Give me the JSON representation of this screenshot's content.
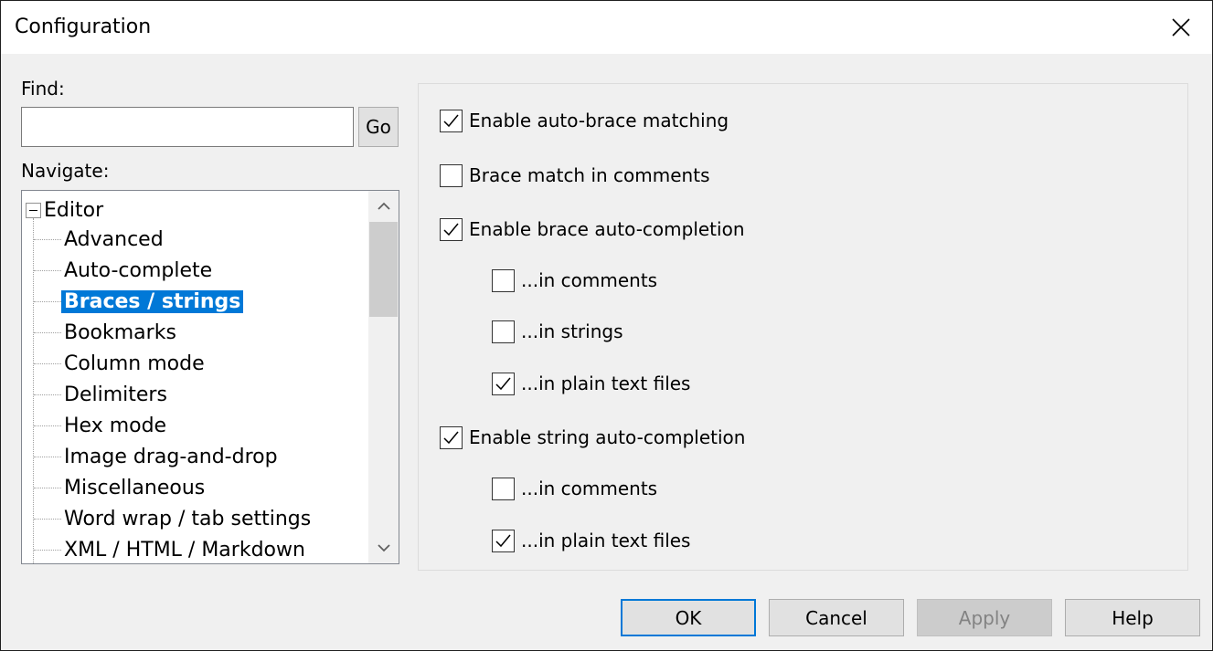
{
  "window": {
    "title": "Configuration"
  },
  "find": {
    "label": "Find:",
    "value": "",
    "go_label": "Go"
  },
  "navigate": {
    "label": "Navigate:",
    "root": "Editor",
    "items": [
      {
        "label": "Advanced",
        "selected": false
      },
      {
        "label": "Auto-complete",
        "selected": false
      },
      {
        "label": "Braces / strings",
        "selected": true
      },
      {
        "label": "Bookmarks",
        "selected": false
      },
      {
        "label": "Column mode",
        "selected": false
      },
      {
        "label": "Delimiters",
        "selected": false
      },
      {
        "label": "Hex mode",
        "selected": false
      },
      {
        "label": "Image drag-and-drop",
        "selected": false
      },
      {
        "label": "Miscellaneous",
        "selected": false
      },
      {
        "label": "Word wrap / tab settings",
        "selected": false
      },
      {
        "label": "XML / HTML / Markdown",
        "selected": false
      }
    ]
  },
  "options": [
    {
      "label": "Enable auto-brace matching",
      "checked": true,
      "indent": 0
    },
    {
      "label": "Brace match in comments",
      "checked": false,
      "indent": 0
    },
    {
      "label": "Enable brace auto-completion",
      "checked": true,
      "indent": 0
    },
    {
      "label": "...in comments",
      "checked": false,
      "indent": 1
    },
    {
      "label": "...in strings",
      "checked": false,
      "indent": 1
    },
    {
      "label": "...in plain text files",
      "checked": true,
      "indent": 1
    },
    {
      "label": "Enable string auto-completion",
      "checked": true,
      "indent": 0
    },
    {
      "label": "...in comments",
      "checked": false,
      "indent": 1
    },
    {
      "label": "...in plain text files",
      "checked": true,
      "indent": 1
    }
  ],
  "buttons": {
    "ok": "OK",
    "cancel": "Cancel",
    "apply": "Apply",
    "help": "Help"
  },
  "icons": {
    "close": "close-icon",
    "scroll_up": "chevron-up-icon",
    "scroll_down": "chevron-down-icon",
    "check": "checkmark-icon"
  },
  "colors": {
    "selection": "#0078d7",
    "dialog_bg": "#f0f0f0"
  }
}
